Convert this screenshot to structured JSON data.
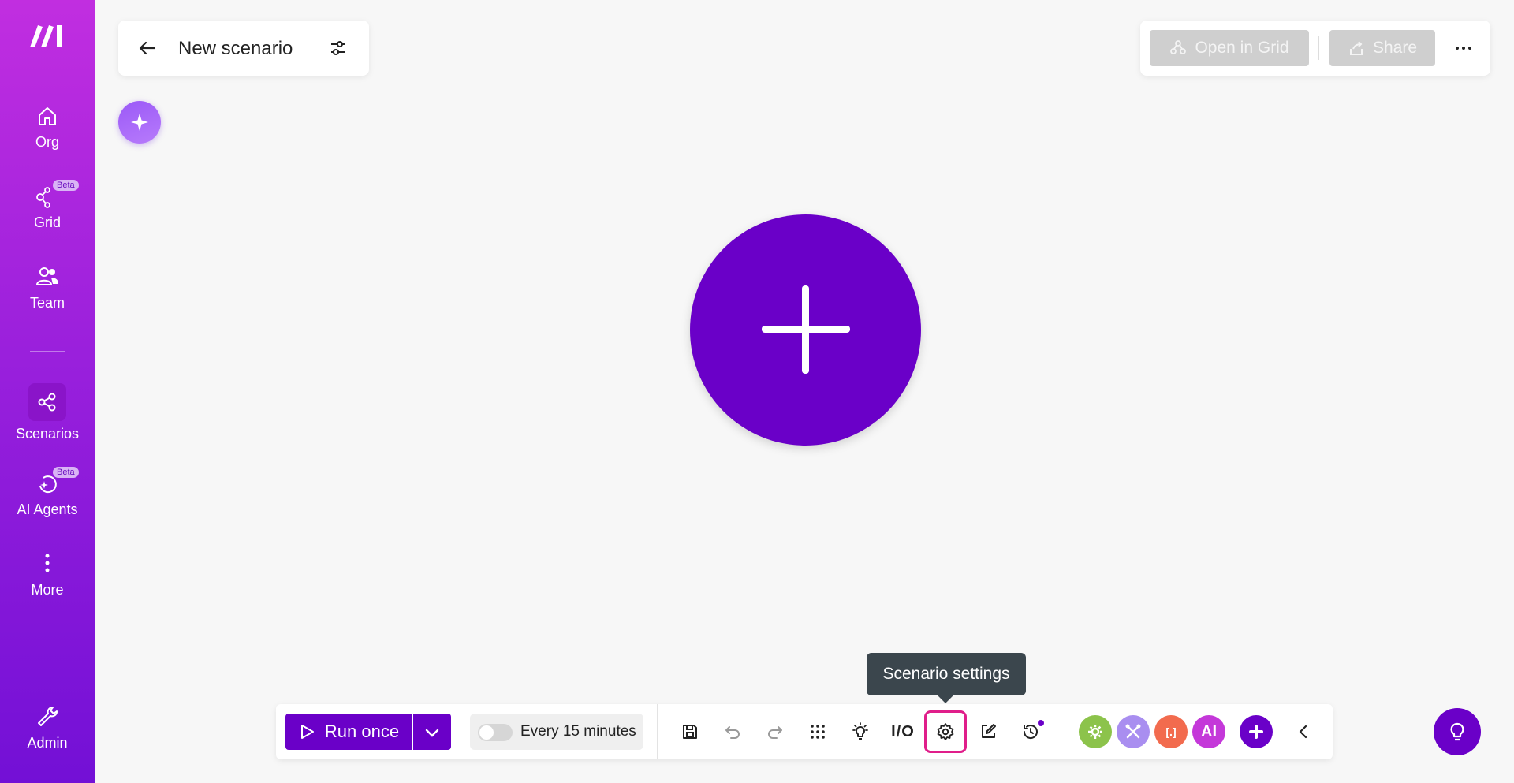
{
  "sidebar": {
    "items": [
      {
        "label": "Org",
        "icon": "home-icon"
      },
      {
        "label": "Grid",
        "icon": "grid-network-icon",
        "badge": "Beta"
      },
      {
        "label": "Team",
        "icon": "team-icon"
      },
      {
        "label": "Scenarios",
        "icon": "share-nodes-icon",
        "active": true
      },
      {
        "label": "AI Agents",
        "icon": "ai-agent-icon",
        "badge": "Beta"
      },
      {
        "label": "More",
        "icon": "more-vertical-icon"
      },
      {
        "label": "Admin",
        "icon": "wrench-icon"
      }
    ]
  },
  "header": {
    "title": "New scenario"
  },
  "right_actions": {
    "open_in_grid": "Open in Grid",
    "share": "Share"
  },
  "toolbar": {
    "run_once": "Run once",
    "schedule": "Every 15 minutes",
    "io_label": "I/O",
    "tooltip": "Scenario settings",
    "apps": [
      {
        "name": "flow-control",
        "color": "#8cc34b"
      },
      {
        "name": "tools",
        "color": "#a98ef0"
      },
      {
        "name": "text-parser",
        "color": "#f26b4e",
        "label": "[.]"
      },
      {
        "name": "ai",
        "color": "#c438d9",
        "label": "AI"
      }
    ]
  },
  "colors": {
    "brand": "#6a00c8",
    "sidebar_top": "#c12ee0",
    "sidebar_bottom": "#7310d6",
    "active_highlight": "#e01e8a"
  }
}
